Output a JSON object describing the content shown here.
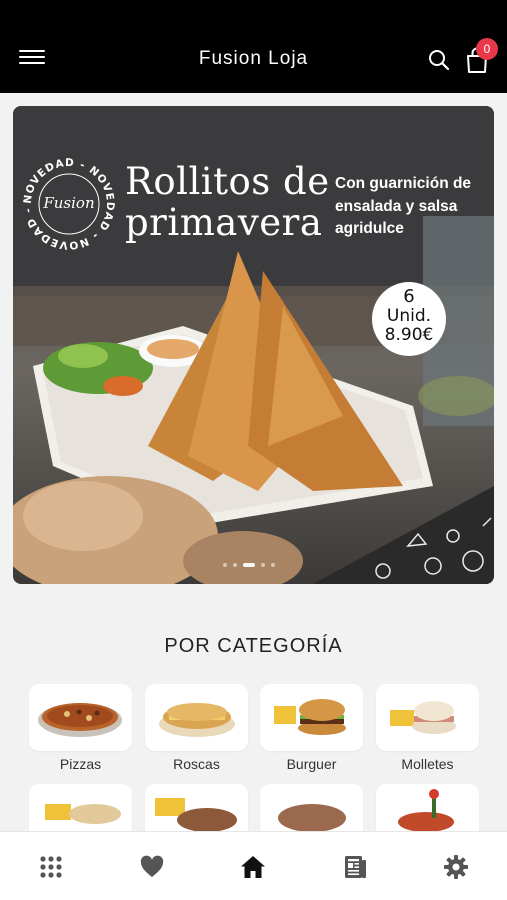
{
  "header": {
    "title": "Fusion Loja",
    "cart_count": "0",
    "icons": {
      "menu": "menu-icon",
      "search": "search-icon",
      "cart": "shopping-bag-icon"
    }
  },
  "banner": {
    "title": "Rollitos de primavera",
    "subtitle": "Con guarnición de ensalada y salsa agridulce",
    "stamp_text": "NOVEDAD - NOVEDAD - NOVEDAD -",
    "stamp_logo": "Fusion",
    "price_qty": "6",
    "price_unit": "Unid.",
    "price_value": "8.90€",
    "slides": 5,
    "active_slide": 2
  },
  "categories": {
    "heading": "POR CATEGORÍA",
    "items": [
      {
        "label": "Pizzas"
      },
      {
        "label": "Roscas"
      },
      {
        "label": "Burguer"
      },
      {
        "label": "Molletes"
      },
      {
        "label": ""
      },
      {
        "label": ""
      },
      {
        "label": ""
      },
      {
        "label": ""
      }
    ]
  },
  "bottom_nav": {
    "items": [
      "apps-grid-icon",
      "heart-icon",
      "home-icon",
      "news-icon",
      "settings-gear-icon"
    ],
    "active": "home-icon"
  },
  "colors": {
    "header_bg": "#000000",
    "badge": "#e8394a",
    "page_bg": "#f2f2f2"
  }
}
